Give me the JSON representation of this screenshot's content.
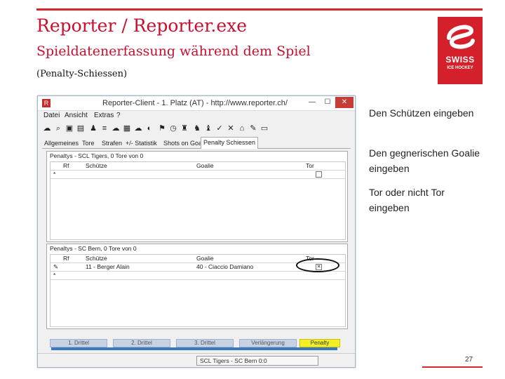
{
  "slide": {
    "title": "Reporter / Reporter.exe",
    "subtitle": "Spieldatenerfassung während dem Spiel",
    "subsub": "(Penalty-Schiessen)",
    "page_number": "27",
    "accent_color": "#c8102e"
  },
  "logo": {
    "line1": "SWISS",
    "line2": "ICE HOCKEY"
  },
  "window": {
    "title": "Reporter-Client - 1. Platz (AT) - http://www.reporter.ch/",
    "min": "—",
    "max": "☐",
    "close": "✕"
  },
  "menu": [
    "Datei",
    "Ansicht",
    "Extras",
    "?"
  ],
  "tabs": [
    "Allgemeines",
    "Tore",
    "Strafen",
    "+/- Statistik",
    "Shots on Goal",
    "Penalty Schiessen"
  ],
  "panel1": {
    "title": "Penaltys - SCL Tigers, 0 Tore von 0",
    "columns": [
      "Rf",
      "Schütze",
      "Goalie",
      "Tor"
    ],
    "new_row_marker": "*"
  },
  "panel2": {
    "title": "Penaltys - SC Bern, 0 Tore von 0",
    "columns": [
      "Rf",
      "Schütze",
      "Goalie",
      "Tor"
    ],
    "row": {
      "marker": "✎",
      "shooter": "11 - Berger Alain",
      "goalie": "40 - Ciaccio Damiano",
      "tor": "✕"
    },
    "new_row_marker": "*"
  },
  "periods": [
    "1. Drittel",
    "2. Drittel",
    "3. Drittel",
    "Verlängerung",
    "Penalty"
  ],
  "status": "SCL Tigers - SC Bern 0:0",
  "callouts": [
    "Den Schützen eingeben",
    "Den gegnerischen Goalie eingeben",
    "Tor oder nicht Tor eingeben"
  ]
}
